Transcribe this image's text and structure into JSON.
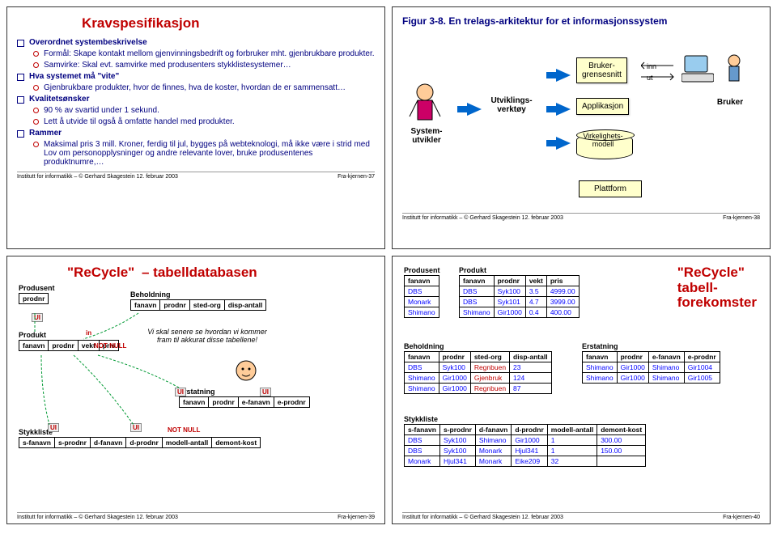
{
  "footer_left": "Institutt for informatikk – © Gerhard Skagestein 12. februar 2003",
  "slide1": {
    "title": "Kravspesifikasjon",
    "b1": "Overordnet systembeskrivelse",
    "s1": "Formål: Skape kontakt mellom gjenvinningsbedrift og forbruker mht. gjenbrukbare produkter.",
    "s2": "Samvirke: Skal evt. samvirke med produsenters stykklistesystemer…",
    "b2": "Hva systemet må \"vite\"",
    "s3": "Gjenbrukbare produkter, hvor de finnes, hva de koster, hvordan de er sammensatt…",
    "b3": "Kvalitetsønsker",
    "s4": "90 % av svartid under 1 sekund.",
    "s5": "Lett å utvide til også å omfatte handel med produkter.",
    "b4": "Rammer",
    "s6": "Maksimal pris 3 mill. Kroner, ferdig til jul, bygges på webteknologi, må ikke være i strid med Lov om personopplysninger og andre relevante lover, bruke produsentenes produktnumre,…",
    "page": "Fra-kjernen-37"
  },
  "slide2": {
    "title": "Figur 3-8. En trelags-arkitektur for et informasjonssystem",
    "l_sysutv": "System-\nutvikler",
    "l_verktoy": "Utviklings-\nverktøy",
    "l_bg": "Bruker-\ngrensesnitt",
    "l_app": "Applikasjon",
    "l_vm": "Virkelighets-\nmodell",
    "l_plat": "Plattform",
    "l_bruker": "Bruker",
    "l_inn": "inn",
    "l_ut": "ut",
    "page": "Fra-kjernen-38"
  },
  "slide3": {
    "title_a": "\"ReCycle\"",
    "title_b": "– tabelldatabasen",
    "t_produsent": "Produsent",
    "t_produkt": "Produkt",
    "t_beholdning": "Beholdning",
    "t_stykkliste": "Stykkliste",
    "t_erstatning": "Erstatning",
    "c_prodnr": "prodnr",
    "c_fanavn": "fanavn",
    "c_vekt": "vekt",
    "c_pris": "pris",
    "c_stedorg": "sted-org",
    "c_dispantall": "disp-antall",
    "c_sfanavn": "s-fanavn",
    "c_sprodnr": "s-prodnr",
    "c_dfanavn": "d-fanavn",
    "c_dprodnr": "d-prodnr",
    "c_modellantall": "modell-antall",
    "c_demontkost": "demont-kost",
    "c_efanavn": "e-fanavn",
    "c_eprodnr": "e-prodnr",
    "note": "Vi skal senere se hvordan vi kommer fram til akkurat disse tabellene!",
    "ui": "UI",
    "in": "in",
    "nn": "NOT NULL",
    "page": "Fra-kjernen-39"
  },
  "slide4": {
    "title_a": "\"ReCycle\"",
    "title_b": "tabell-\nforekomster",
    "t_produsent": "Produsent",
    "t_produkt": "Produkt",
    "t_beholdning": "Beholdning",
    "t_erstatning": "Erstatning",
    "t_stykkliste": "Stykkliste",
    "produsent": {
      "head": [
        "fanavn"
      ],
      "rows": [
        [
          "DBS"
        ],
        [
          "Monark"
        ],
        [
          "Shimano"
        ]
      ]
    },
    "produkt": {
      "head": [
        "fanavn",
        "prodnr",
        "vekt",
        "pris"
      ],
      "rows": [
        [
          "DBS",
          "Syk100",
          "3.5",
          "4999.00"
        ],
        [
          "DBS",
          "Syk101",
          "4.7",
          "3999.00"
        ],
        [
          "Shimano",
          "Gir1000",
          "0.4",
          "400.00"
        ]
      ]
    },
    "beholdning": {
      "head": [
        "fanavn",
        "prodnr",
        "sted-org",
        "disp-antall"
      ],
      "rows": [
        [
          "DBS",
          "Syk100",
          "Regnbuen",
          "23"
        ],
        [
          "Shimano",
          "Gir1000",
          "Gjenbruk",
          "124"
        ],
        [
          "Shimano",
          "Gir1000",
          "Regnbuen",
          "87"
        ]
      ]
    },
    "erstatning": {
      "head": [
        "fanavn",
        "prodnr",
        "e-fanavn",
        "e-prodnr"
      ],
      "rows": [
        [
          "Shimano",
          "Gir1000",
          "Shimano",
          "Gir1004"
        ],
        [
          "Shimano",
          "Gir1000",
          "Shimano",
          "Gir1005"
        ]
      ]
    },
    "stykkliste": {
      "head": [
        "s-fanavn",
        "s-prodnr",
        "d-fanavn",
        "d-prodnr",
        "modell-antall",
        "demont-kost"
      ],
      "rows": [
        [
          "DBS",
          "Syk100",
          "Shimano",
          "Gir1000",
          "1",
          "300.00"
        ],
        [
          "DBS",
          "Syk100",
          "Monark",
          "Hjul341",
          "1",
          "150.00"
        ],
        [
          "Monark",
          "Hjul341",
          "Monark",
          "Eike209",
          "32",
          ""
        ]
      ]
    },
    "page": "Fra-kjernen-40"
  }
}
